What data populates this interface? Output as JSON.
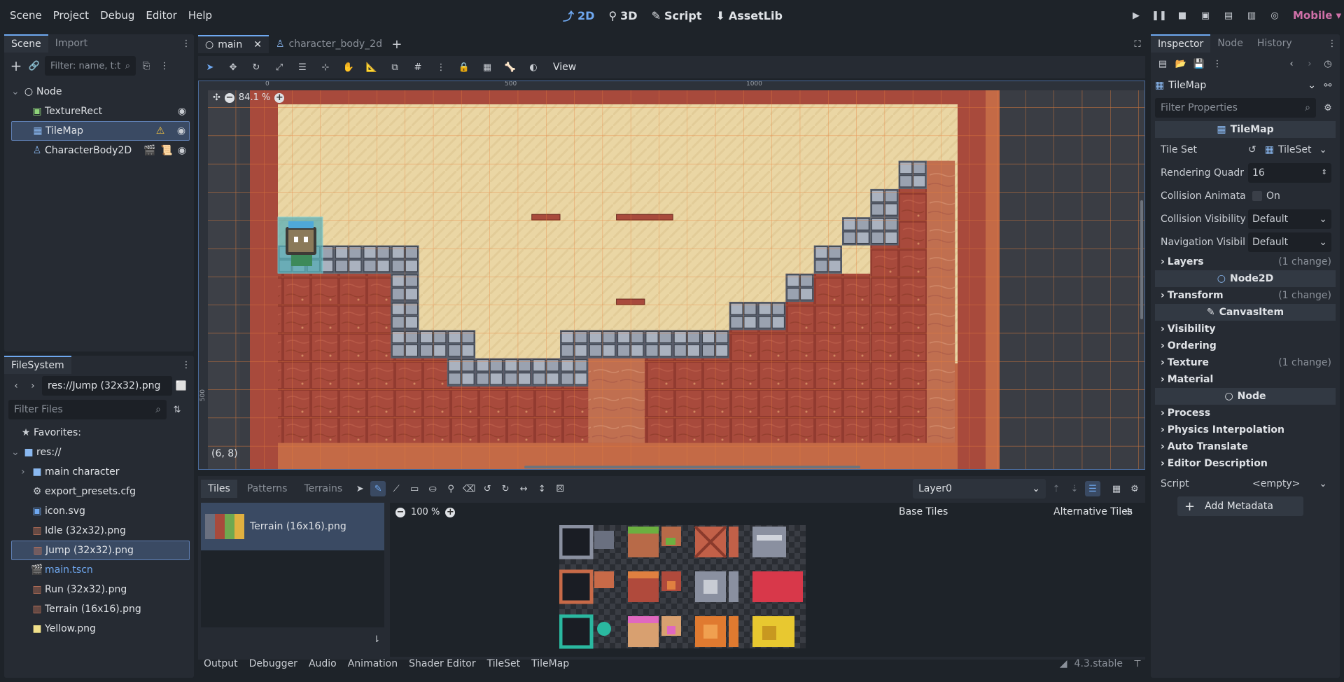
{
  "menu": [
    "Scene",
    "Project",
    "Debug",
    "Editor",
    "Help"
  ],
  "workspaces": {
    "w2d": "2D",
    "w3d": "3D",
    "script": "Script",
    "assetlib": "AssetLib"
  },
  "renderer": "Mobile",
  "scene_dock": {
    "tabs": [
      "Scene",
      "Import"
    ],
    "filter_placeholder": "Filter: name, t:t",
    "nodes": [
      {
        "name": "Node",
        "icon": "node-icon"
      },
      {
        "name": "TextureRect",
        "icon": "texturerect-icon"
      },
      {
        "name": "TileMap",
        "icon": "tilemap-icon"
      },
      {
        "name": "CharacterBody2D",
        "icon": "characterbody-icon"
      }
    ]
  },
  "filesystem": {
    "title": "FileSystem",
    "path": "res://Jump (32x32).png",
    "filter_placeholder": "Filter Files",
    "favorites": "Favorites:",
    "root": "res://",
    "items": [
      "main character",
      "export_presets.cfg",
      "icon.svg",
      "Idle (32x32).png",
      "Jump (32x32).png",
      "main.tscn",
      "Run (32x32).png",
      "Terrain (16x16).png",
      "Yellow.png"
    ]
  },
  "editor_tabs": [
    "main",
    "character_body_2d"
  ],
  "viewport": {
    "toolbar_view": "View",
    "zoom": "84.1 %",
    "coords": "(6, 8)",
    "ruler_marks": [
      "0",
      "500",
      "1000"
    ],
    "ruler_v_mark": "500"
  },
  "tilemap_panel": {
    "tabs": [
      "Tiles",
      "Patterns",
      "Terrains"
    ],
    "layer": "Layer0",
    "source": "Terrain (16x16).png",
    "zoom": "100 %",
    "base_tiles": "Base Tiles",
    "alt_tiles": "Alternative Tiles"
  },
  "bottom_tabs": [
    "Output",
    "Debugger",
    "Audio",
    "Animation",
    "Shader Editor",
    "TileSet",
    "TileMap"
  ],
  "version": "4.3.stable",
  "inspector": {
    "tabs": [
      "Inspector",
      "Node",
      "History"
    ],
    "object": "TileMap",
    "filter_placeholder": "Filter Properties",
    "class_title": "TileMap",
    "props": [
      {
        "label": "Tile Set",
        "value": "TileSet"
      },
      {
        "label": "Rendering Quadr",
        "value": "16"
      },
      {
        "label": "Collision Animata",
        "value": "On"
      },
      {
        "label": "Collision Visibility",
        "value": "Default"
      },
      {
        "label": "Navigation Visibil",
        "value": "Default"
      }
    ],
    "sections_a": [
      {
        "name": "Layers",
        "change": "(1 change)"
      }
    ],
    "node2d": "Node2D",
    "sections_b": [
      {
        "name": "Transform",
        "change": "(1 change)"
      }
    ],
    "canvasitem": "CanvasItem",
    "sections_c": [
      {
        "name": "Visibility",
        "change": ""
      },
      {
        "name": "Ordering",
        "change": ""
      },
      {
        "name": "Texture",
        "change": "(1 change)"
      },
      {
        "name": "Material",
        "change": ""
      }
    ],
    "node": "Node",
    "sections_d": [
      {
        "name": "Process"
      },
      {
        "name": "Physics Interpolation"
      },
      {
        "name": "Auto Translate"
      },
      {
        "name": "Editor Description"
      }
    ],
    "script_label": "Script",
    "script_value": "<empty>",
    "add_metadata": "Add Metadata"
  },
  "colors": {
    "accent": "#6fa8f0",
    "warning": "#f0c040",
    "renderer": "#d070a8",
    "sand": "#ead6a4",
    "brick": "#a84a3c"
  }
}
